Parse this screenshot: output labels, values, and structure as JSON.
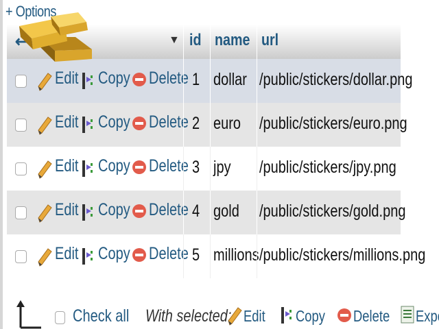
{
  "options_link": "+ Options",
  "header": {
    "columns": [
      "id",
      "name",
      "url"
    ]
  },
  "rows": [
    {
      "id": "1",
      "name": "dollar",
      "url": "/public/stickers/dollar.png"
    },
    {
      "id": "2",
      "name": "euro",
      "url": "/public/stickers/euro.png"
    },
    {
      "id": "3",
      "name": "jpy",
      "url": "/public/stickers/jpy.png"
    },
    {
      "id": "4",
      "name": "gold",
      "url": "/public/stickers/gold.png"
    },
    {
      "id": "5",
      "name": "millions",
      "url": "/public/stickers/millions.png"
    }
  ],
  "row_actions": {
    "edit": "Edit",
    "copy": "Copy",
    "delete": "Delete"
  },
  "footer": {
    "check_all": "Check all",
    "with_selected": "With selected:",
    "edit": "Edit",
    "copy": "Copy",
    "delete": "Delete",
    "export": "Expo"
  },
  "colors": {
    "link": "#235a81",
    "row_alt": "#e5e5e5",
    "row_selected": "#d8dde6",
    "delete_red": "#e25b4b",
    "edit_pencil": "#e8a93a"
  }
}
